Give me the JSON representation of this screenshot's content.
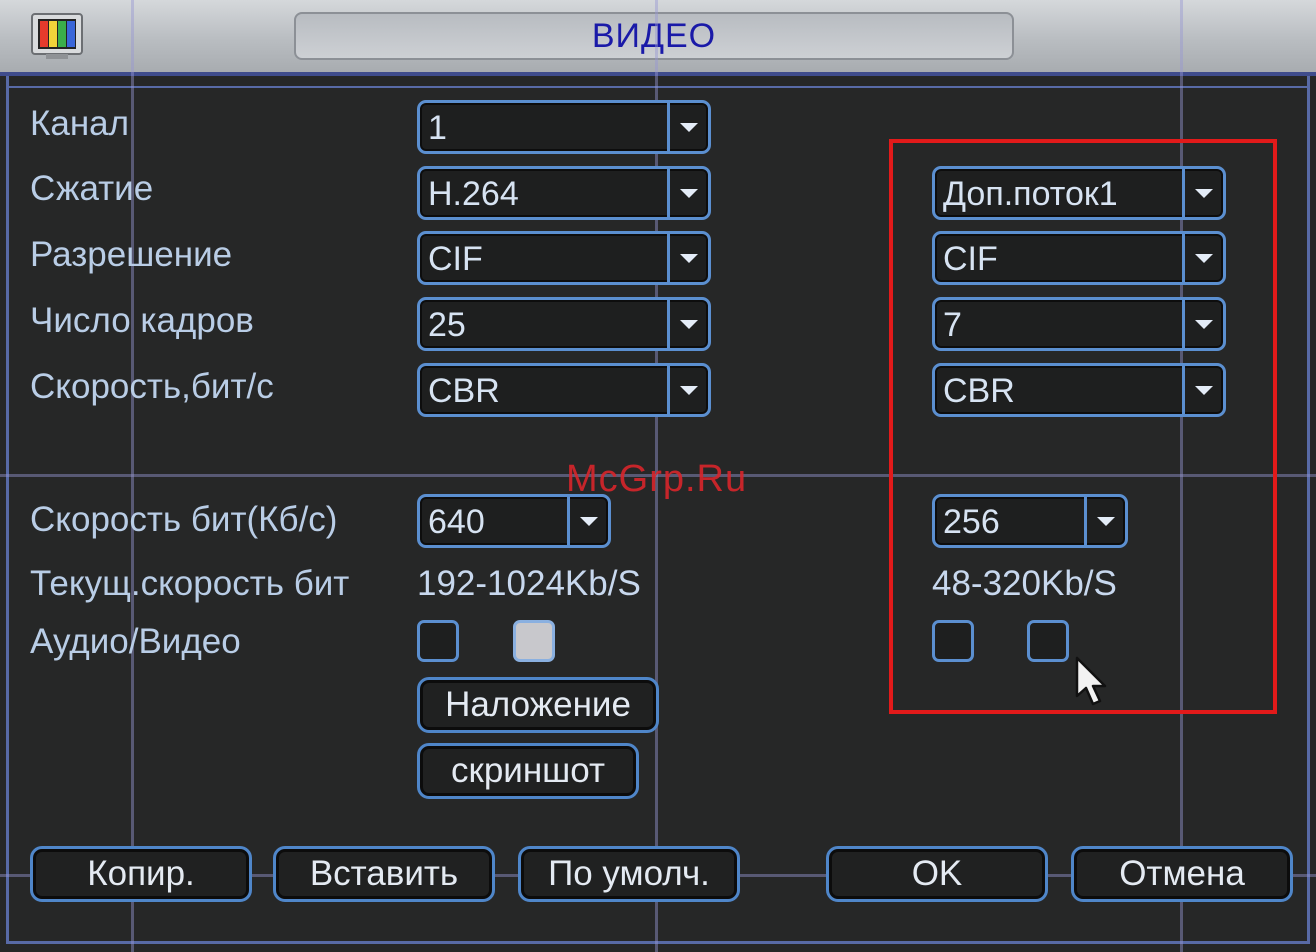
{
  "window": {
    "title": "ВИДЕО"
  },
  "labels": {
    "channel": "Канал",
    "compression": "Сжатие",
    "resolution": "Разрешение",
    "frame_rate": "Число кадров",
    "bitrate_type": "Скорость,бит/с",
    "bitrate": "Скорость бит(Кб/с)",
    "current_bitrate": "Текущ.скорость бит",
    "audio_video": "Аудио/Видео"
  },
  "main_stream": {
    "channel": "1",
    "compression": "H.264",
    "resolution": "CIF",
    "frame_rate": "25",
    "bitrate_type": "CBR",
    "bitrate": "640",
    "current_bitrate": "192-1024Kb/S",
    "audio_checked": false,
    "video_checked": true
  },
  "extra_stream": {
    "stream": "Доп.поток1",
    "resolution": "CIF",
    "frame_rate": "7",
    "bitrate_type": "CBR",
    "bitrate": "256",
    "current_bitrate": "48-320Kb/S",
    "audio_checked": false,
    "video_checked": false
  },
  "buttons": {
    "overlay": "Наложение",
    "snapshot": "скриншот",
    "copy": "Копир.",
    "paste": "Вставить",
    "default": "По умолч.",
    "ok": "OK",
    "cancel": "Отмена"
  },
  "watermark": "McGrp.Ru",
  "colors": {
    "highlight_box": "#e21a1a",
    "title_text": "#1a1aa8",
    "control_border": "#5b8fd0"
  }
}
